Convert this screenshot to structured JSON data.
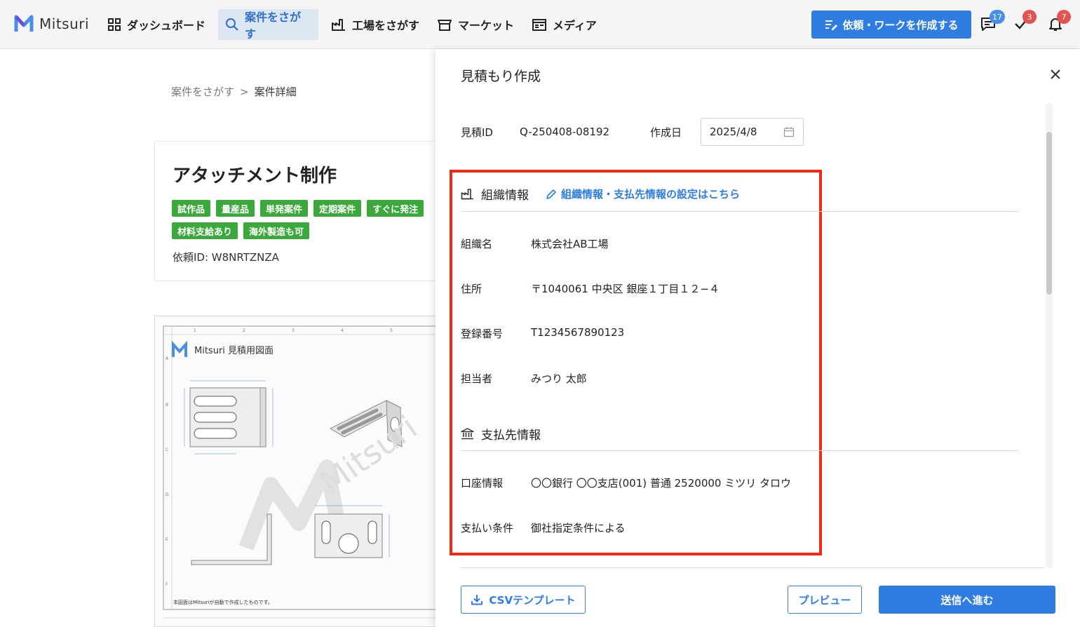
{
  "brand": {
    "name": "Mitsuri"
  },
  "nav": {
    "items": [
      {
        "label": "ダッシュボード",
        "icon": "grid-icon"
      },
      {
        "label": "案件をさがす",
        "icon": "search-icon",
        "active": true
      },
      {
        "label": "工場をさがす",
        "icon": "factory-icon"
      },
      {
        "label": "マーケット",
        "icon": "store-icon"
      },
      {
        "label": "メディア",
        "icon": "newspaper-icon"
      }
    ],
    "create_label": "依頼・ワークを作成する",
    "messages_badge": "17",
    "tasks_badge": "3",
    "notifications_badge": "7"
  },
  "background": {
    "breadcrumb": {
      "parent": "案件をさがす",
      "separator": ">",
      "current": "案件詳細"
    },
    "project": {
      "title": "アタッチメント制作",
      "tags": [
        "試作品",
        "量産品",
        "単発案件",
        "定期案件",
        "すぐに発注",
        "材料支給あり",
        "海外製造も可"
      ],
      "request_id": "依頼ID: W8NRTZNZA"
    },
    "drawing": {
      "title": "Mitsuri 見積用図面",
      "watermark": "Mitsuri",
      "note": "本図面はMitsuriが自動で作成したものです。"
    }
  },
  "panel": {
    "title": "見積もり作成",
    "quote_id_label": "見積ID",
    "quote_id": "Q-250408-08192",
    "date_label": "作成日",
    "date_value": "2025/4/8",
    "org_section": {
      "title": "組織情報",
      "link": "組織情報・支払先情報の設定はこちら",
      "rows": [
        {
          "label": "組織名",
          "value": "株式会社AB工場"
        },
        {
          "label": "住所",
          "value": "〒1040061 中央区 銀座１丁目１２−４"
        },
        {
          "label": "登録番号",
          "value": "T1234567890123"
        },
        {
          "label": "担当者",
          "value": "みつり 太郎"
        }
      ]
    },
    "payment_section": {
      "title": "支払先情報",
      "rows": [
        {
          "label": "口座情報",
          "value": "〇〇銀行 〇〇支店(001) 普通 2520000 ミツリ タロウ"
        },
        {
          "label": "支払い条件",
          "value": "御社指定条件による"
        }
      ]
    },
    "footer": {
      "csv_label": "CSVテンプレート",
      "preview_label": "プレビュー",
      "submit_label": "送信へ進む"
    }
  },
  "colors": {
    "primary": "#2f7de1",
    "tag_green": "#3aa83a",
    "highlight": "#ee2a10",
    "badge_red": "#e2544f",
    "badge_blue": "#4a8fe7"
  }
}
